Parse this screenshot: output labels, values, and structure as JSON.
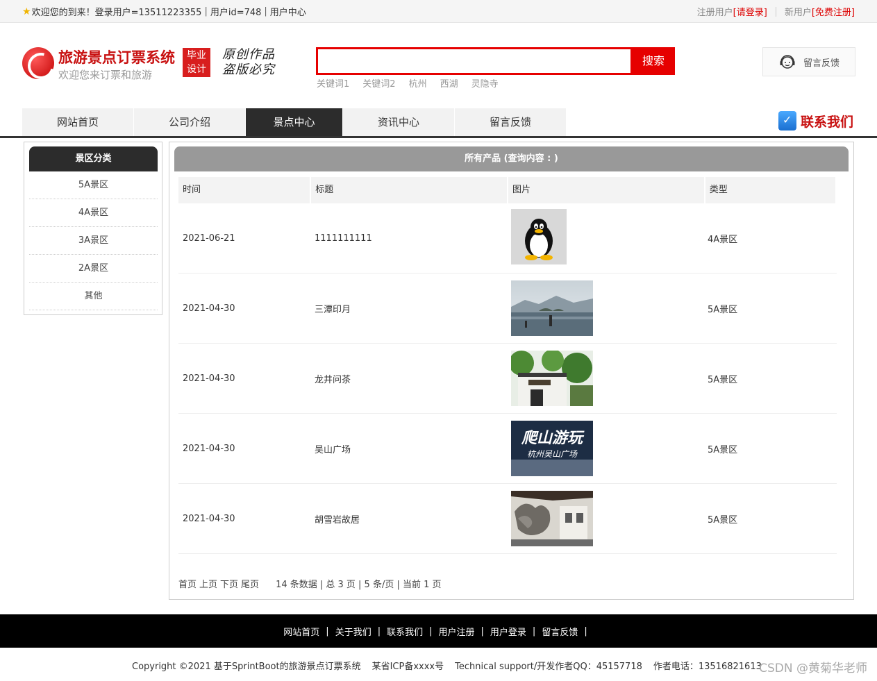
{
  "topbar": {
    "welcome": "欢迎您的到来！登录用户=13511223355",
    "userid": "用户id=748",
    "usercenter": "用户中心",
    "register_user": "注册用户",
    "login": "[请登录]",
    "new_user": "新用户",
    "free_register": "[免费注册]"
  },
  "header": {
    "title": "旅游景点订票系统",
    "subtitle": "欢迎您来订票和旅游",
    "badge_line1": "毕业",
    "badge_line2": "设计",
    "slogan_line1": "原创作品",
    "slogan_line2": "盗版必究",
    "search_button": "搜索",
    "search_value": "",
    "hotwords": [
      "关键词1",
      "关键词2",
      "杭州",
      "西湖",
      "灵隐寺"
    ],
    "feedback": "留言反馈"
  },
  "nav": {
    "items": [
      "网站首页",
      "公司介绍",
      "景点中心",
      "资讯中心",
      "留言反馈"
    ],
    "contact": "联系我们"
  },
  "sidebar": {
    "title": "景区分类",
    "items": [
      "5A景区",
      "4A景区",
      "3A景区",
      "2A景区",
      "其他"
    ]
  },
  "main": {
    "title": "所有产品 (查询内容 : )",
    "columns": [
      "时间",
      "标题",
      "图片",
      "类型"
    ],
    "rows": [
      {
        "date": "2021-06-21",
        "title": "1111111111",
        "type": "4A景区",
        "image": "penguin-image"
      },
      {
        "date": "2021-04-30",
        "title": "三潭印月",
        "type": "5A景区",
        "image": "lake-image"
      },
      {
        "date": "2021-04-30",
        "title": "龙井问茶",
        "type": "5A景区",
        "image": "tea-garden-image"
      },
      {
        "date": "2021-04-30",
        "title": "吴山广场",
        "type": "5A景区",
        "image": "mountain-poster-image"
      },
      {
        "date": "2021-04-30",
        "title": "胡雪岩故居",
        "type": "5A景区",
        "image": "old-house-image"
      }
    ],
    "poster_text": "爬山游玩",
    "poster_subtext": "杭州吴山广场",
    "pager": {
      "first": "首页",
      "prev": "上页",
      "next": "下页",
      "last": "尾页",
      "info": "14 条数据 | 总 3 页 | 5 条/页 | 当前 1 页"
    }
  },
  "footer": {
    "links": [
      "网站首页",
      "关于我们",
      "联系我们",
      "用户注册",
      "用户登录",
      "留言反馈"
    ],
    "separator": "|",
    "copyright": "Copyright ©2021 基于SprintBoot的旅游景点订票系统",
    "icp": "某省ICP备xxxx号",
    "support": "Technical support/开发作者QQ：45157718",
    "phone": "作者电话：13516821613",
    "watermark": "CSDN @黄菊华老师"
  },
  "colors": {
    "brand_red": "#e60000",
    "dark": "#2c2c2c",
    "header_gray": "#999999"
  }
}
